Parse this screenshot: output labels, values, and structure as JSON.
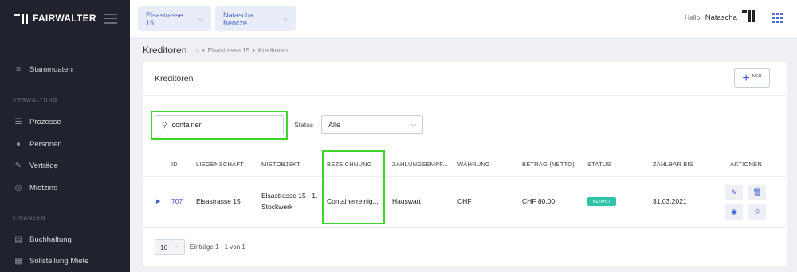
{
  "app": {
    "brand": "FAIRWALTER"
  },
  "sidebar": {
    "items": [
      {
        "label": "Stammdaten",
        "icon": "database-icon"
      },
      {
        "label": "Prozesse",
        "icon": "list-icon"
      },
      {
        "label": "Personen",
        "icon": "people-icon"
      },
      {
        "label": "Verträge",
        "icon": "contract-icon"
      },
      {
        "label": "Mietzins",
        "icon": "coins-icon"
      },
      {
        "label": "Buchhaltung",
        "icon": "ledger-icon"
      },
      {
        "label": "Sollstellung Miete",
        "icon": "invoice-icon"
      }
    ],
    "sections": {
      "verwaltung": "VERWALTUNG",
      "finanzen": "FINANZEN"
    }
  },
  "topbar": {
    "property": "Elsastrasse 15",
    "person": "Natascha Bencze",
    "greeting": "Hallo,",
    "user": "Natascha"
  },
  "page": {
    "title": "Kreditoren",
    "breadcrumb": [
      "Elsastrasse 15",
      "Kreditoren"
    ]
  },
  "card": {
    "title": "Kreditoren",
    "new_label": "NEU",
    "search_value": "container",
    "status_label": "Status",
    "status_value": "Alle"
  },
  "table": {
    "headers": [
      "ID",
      "LIEGENSCHAFT",
      "MIETOBJEKT",
      "BEZEICHNUNG",
      "ZAHLUNGSEMPF...",
      "WÄHRUNG",
      "BETRAG (NETTO)",
      "STATUS",
      "ZAHLBAR BIS",
      "AKTIONEN"
    ],
    "rows": [
      {
        "id": "707",
        "liegenschaft": "Elsastrasse 15",
        "mietobjekt_line1": "Elsastrasse 15 - 1.",
        "mietobjekt_line2": "Stockwerk",
        "bezeichnung": "Containerreinig...",
        "zahlungsempfaenger": "Hauswart",
        "waehrung": "CHF",
        "betrag": "CHF 80.00",
        "status": "BEZAHLT",
        "zahlbar_bis": "31.03.2021"
      }
    ]
  },
  "footer": {
    "page_size": "10",
    "entries": "Einträge 1 - 1 von 1"
  },
  "colors": {
    "accent": "#3d5bd1",
    "sidebar": "#20232d",
    "highlight": "#3ed52a",
    "status_paid": "#2fc3a6"
  }
}
